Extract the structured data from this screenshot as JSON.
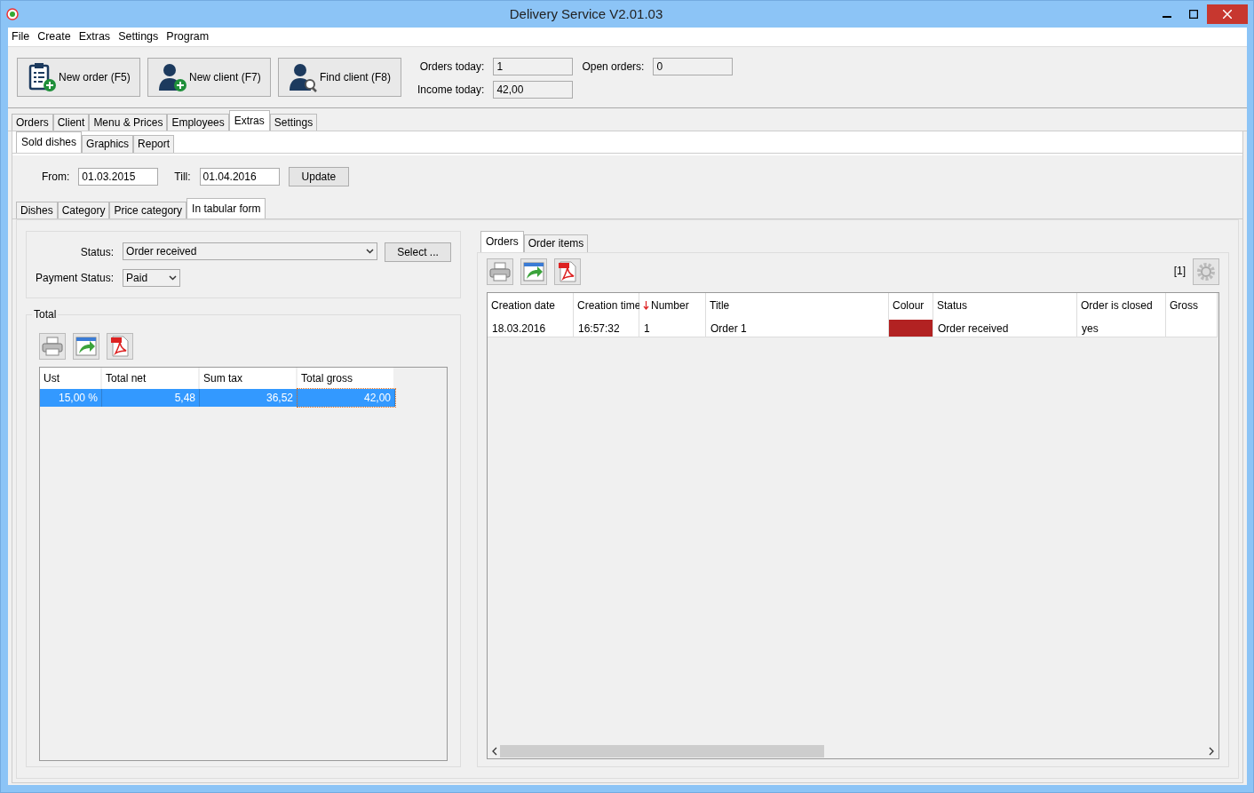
{
  "window": {
    "title": "Delivery Service V2.01.03"
  },
  "menu": [
    "File",
    "Create",
    "Extras",
    "Settings",
    "Program"
  ],
  "toolbar": {
    "buttons": [
      {
        "label": "New order (F5)",
        "kind": "order"
      },
      {
        "label": "New client (F7)",
        "kind": "client"
      },
      {
        "label": "Find client (F8)",
        "kind": "find"
      }
    ],
    "stats": [
      {
        "label": "Orders today:",
        "value": "1"
      },
      {
        "label": "Income today:",
        "value": "42,00"
      },
      {
        "label": "Open orders:",
        "value": "0"
      }
    ]
  },
  "main_tabs": [
    {
      "label": "Orders",
      "selected": false
    },
    {
      "label": "Client",
      "selected": false
    },
    {
      "label": "Menu & Prices",
      "selected": false
    },
    {
      "label": "Employees",
      "selected": false
    },
    {
      "label": "Extras",
      "selected": true
    },
    {
      "label": "Settings",
      "selected": false
    }
  ],
  "sub_tabs": [
    {
      "label": "Sold dishes",
      "selected": true
    },
    {
      "label": "Graphics",
      "selected": false
    },
    {
      "label": "Report",
      "selected": false
    }
  ],
  "date_filter": {
    "from_label": "From:",
    "from": "01.03.2015",
    "till_label": "Till:",
    "till": "01.04.2016",
    "button": "Update"
  },
  "view_tabs": [
    {
      "label": "Dishes",
      "selected": false
    },
    {
      "label": "Category",
      "selected": false
    },
    {
      "label": "Price category",
      "selected": false
    },
    {
      "label": "In tabular form",
      "selected": true
    }
  ],
  "filter": {
    "status_label": "Status:",
    "status": "Order received",
    "select_button": "Select ...",
    "payment_label": "Payment Status:",
    "payment": "Paid"
  },
  "total": {
    "title": "Total",
    "columns": [
      "Ust",
      "Total net",
      "Sum tax",
      "Total gross"
    ],
    "rows": [
      {
        "cells": [
          "15,00 %",
          "5,48",
          "36,52",
          "42,00"
        ],
        "selected": true
      }
    ]
  },
  "orders_panel": {
    "tabs": [
      {
        "label": "Orders",
        "selected": true
      },
      {
        "label": "Order items",
        "selected": false
      }
    ],
    "count": "[1]",
    "columns": [
      {
        "label": "Creation date",
        "sorted": false
      },
      {
        "label": "Creation time",
        "sorted": false
      },
      {
        "label": "Number",
        "sorted": true
      },
      {
        "label": "Title",
        "sorted": false
      },
      {
        "label": "Colour",
        "sorted": false
      },
      {
        "label": "Status",
        "sorted": false
      },
      {
        "label": "Order is closed",
        "sorted": false
      },
      {
        "label": "Gross",
        "sorted": false
      }
    ],
    "rows": [
      {
        "cells": [
          {
            "text": "18.03.2016"
          },
          {
            "text": "16:57:32"
          },
          {
            "text": "1"
          },
          {
            "text": "Order 1"
          },
          {
            "color": "#b22222"
          },
          {
            "text": "Order received"
          },
          {
            "text": "yes"
          }
        ]
      }
    ]
  }
}
